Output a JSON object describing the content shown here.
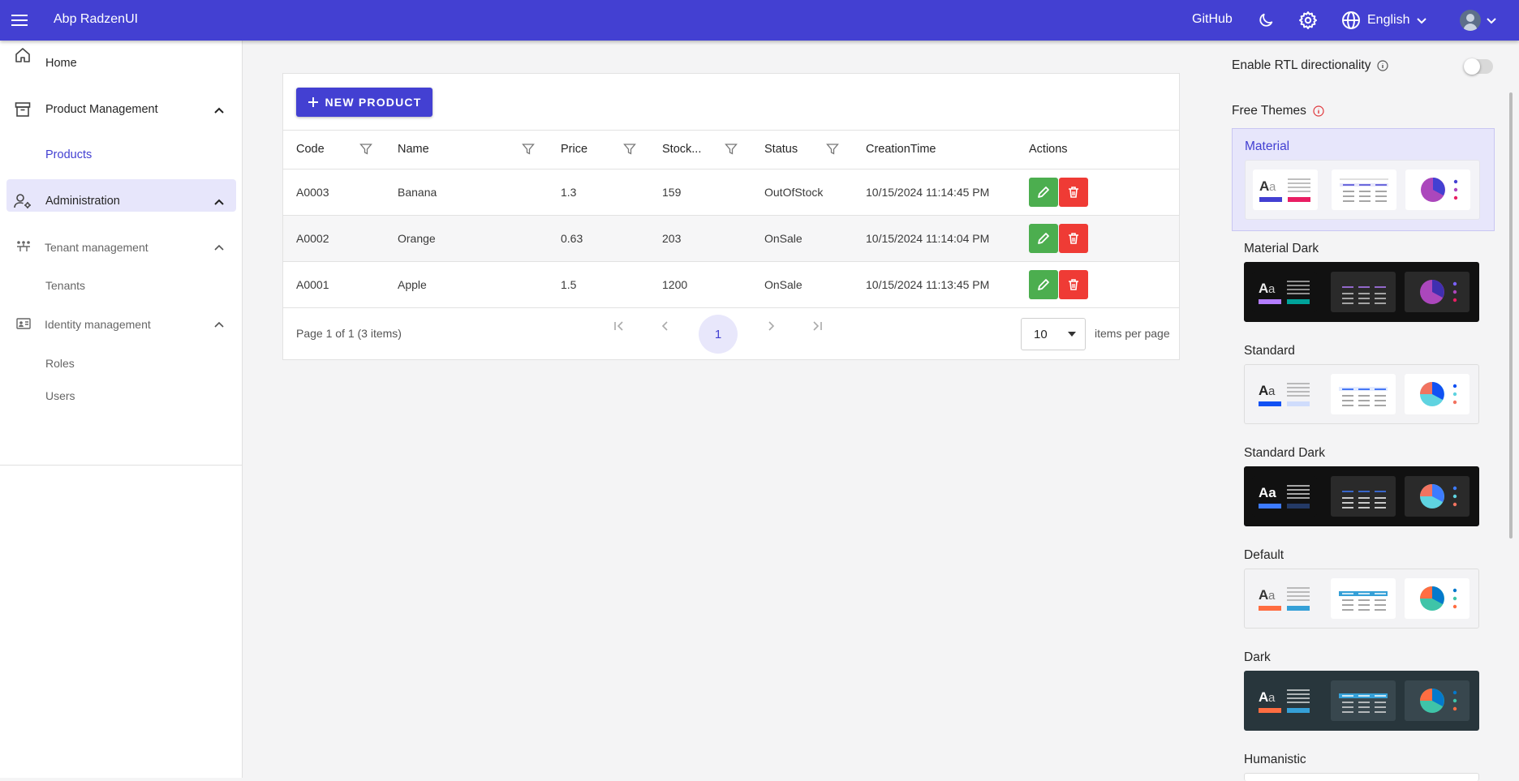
{
  "header": {
    "app_title": "Abp RadzenUI",
    "github": "GitHub",
    "language": "English"
  },
  "sidebar": {
    "home": "Home",
    "product_management": "Product Management",
    "products": "Products",
    "administration": "Administration",
    "tenant_management": "Tenant management",
    "tenants": "Tenants",
    "identity_management": "Identity management",
    "roles": "Roles",
    "users": "Users"
  },
  "grid": {
    "new_button": "NEW PRODUCT",
    "columns": [
      "Code",
      "Name",
      "Price",
      "Stock...",
      "Status",
      "CreationTime",
      "Actions"
    ],
    "rows": [
      {
        "code": "A0003",
        "name": "Banana",
        "price": "1.3",
        "stock": "159",
        "status": "OutOfStock",
        "created": "10/15/2024 11:14:45 PM"
      },
      {
        "code": "A0002",
        "name": "Orange",
        "price": "0.63",
        "stock": "203",
        "status": "OnSale",
        "created": "10/15/2024 11:14:04 PM"
      },
      {
        "code": "A0001",
        "name": "Apple",
        "price": "1.5",
        "stock": "1200",
        "status": "OnSale",
        "created": "10/15/2024 11:13:45 PM"
      }
    ],
    "pager_summary": "Page 1 of 1 (3 items)",
    "current_page": "1",
    "page_size": "10",
    "items_per_page": "items per page"
  },
  "theme_panel": {
    "rtl_label": "Enable RTL directionality",
    "free_themes_label": "Free Themes",
    "themes": [
      "Material",
      "Material Dark",
      "Standard",
      "Standard Dark",
      "Default",
      "Dark",
      "Humanistic"
    ],
    "selected": "Material"
  },
  "colors": {
    "primary": "#4340d2",
    "edit": "#4cae4f",
    "delete": "#ef3b35"
  }
}
